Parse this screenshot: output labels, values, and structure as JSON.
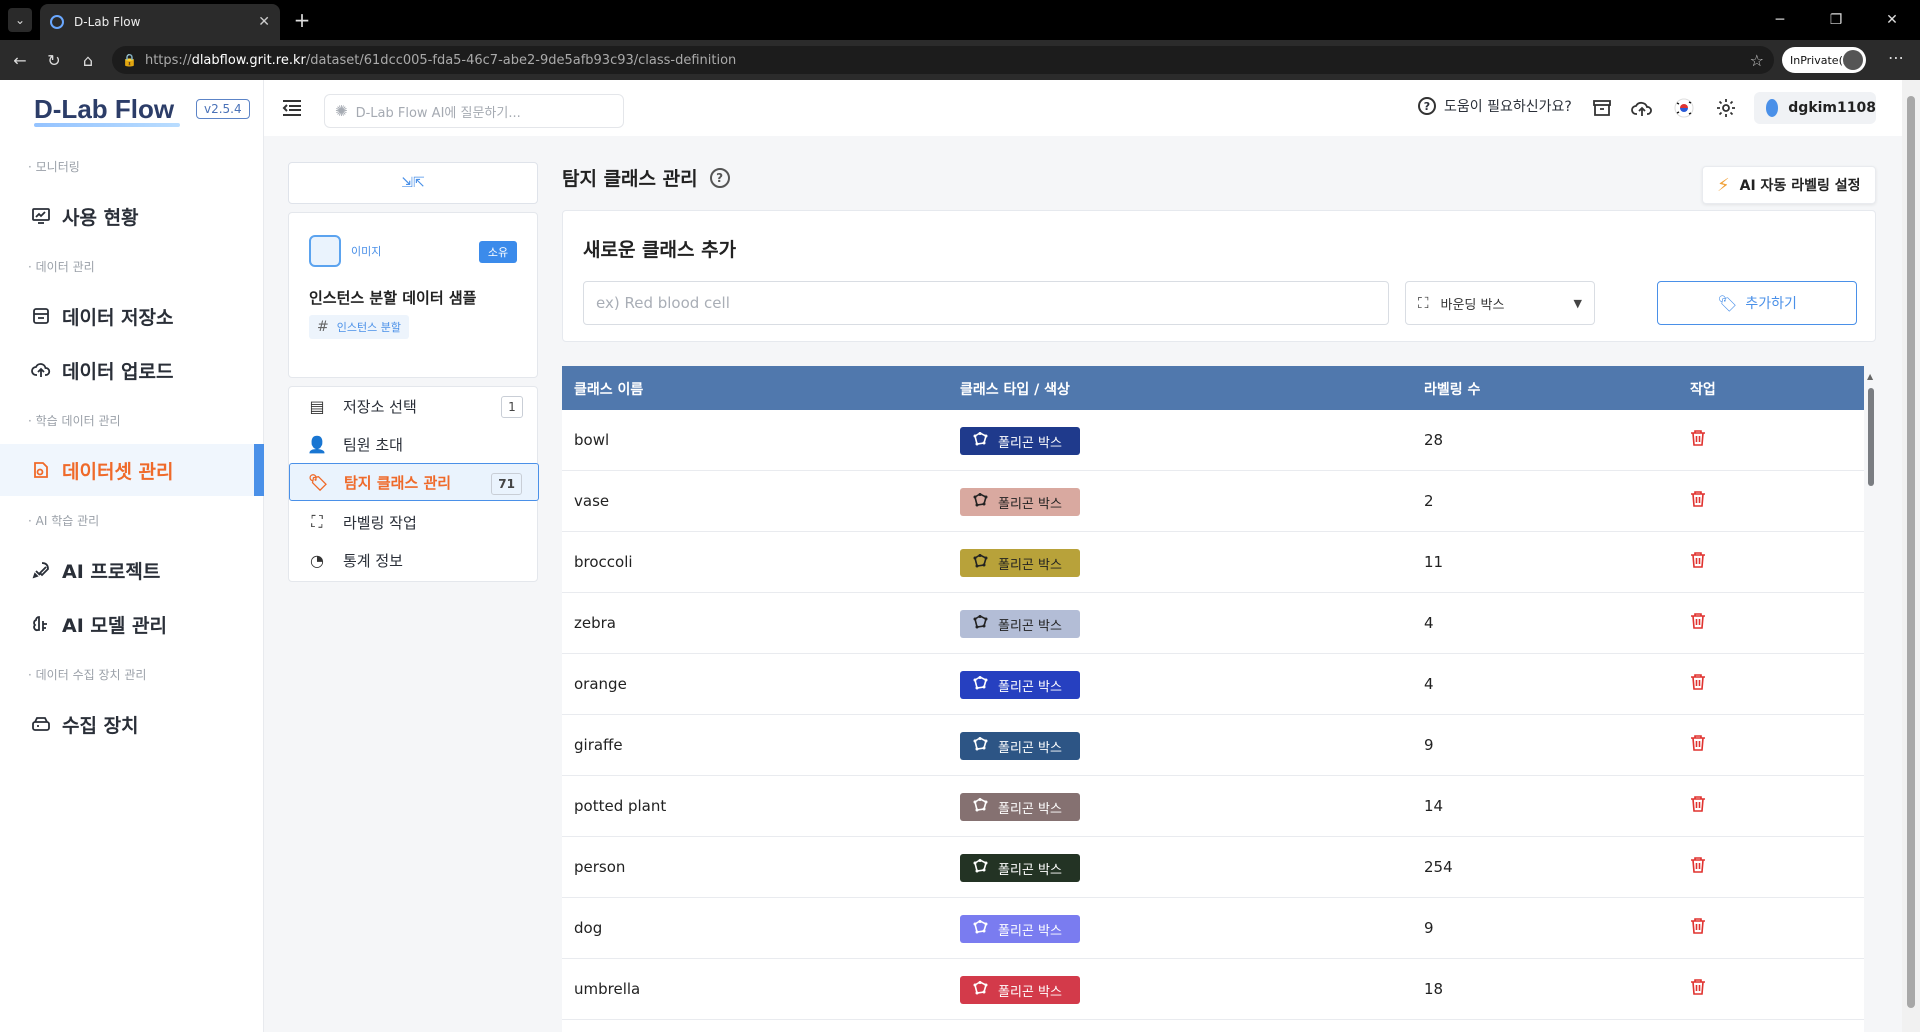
{
  "browser": {
    "tab_title": "D-Lab Flow",
    "url_prefix": "https://",
    "url_host": "dlabflow.grit.re.kr",
    "url_path": "/dataset/61dcc005-fda5-46c7-abe2-9de5afb93c93/class-definition",
    "inprivate_label": "InPrivate(2)"
  },
  "logo": {
    "text": "D-Lab Flow",
    "version": "v2.5.4"
  },
  "sidebar": {
    "sections": [
      {
        "label": "· 모니터링",
        "items": [
          {
            "label": "사용 현황",
            "icon": "monitor-chart-icon"
          }
        ]
      },
      {
        "label": "· 데이터 관리",
        "items": [
          {
            "label": "데이터 저장소",
            "icon": "storage-icon"
          },
          {
            "label": "데이터 업로드",
            "icon": "cloud-upload-icon"
          }
        ]
      },
      {
        "label": "· 학습 데이터 관리",
        "items": [
          {
            "label": "데이터셋 관리",
            "icon": "dataset-icon",
            "active": true
          }
        ]
      },
      {
        "label": "· AI 학습 관리",
        "items": [
          {
            "label": "AI 프로젝트",
            "icon": "rocket-icon"
          },
          {
            "label": "AI 모델 관리",
            "icon": "brain-icon"
          }
        ]
      },
      {
        "label": "· 데이터 수집 장치 관리",
        "items": [
          {
            "label": "수집 장치",
            "icon": "device-icon"
          }
        ]
      }
    ]
  },
  "header": {
    "ai_search_placeholder": "D-Lab Flow AI에 질문하기...",
    "help_label": "도움이 필요하신가요?",
    "username": "dgkim1108"
  },
  "dataset": {
    "type_label": "이미지",
    "badge": "소유",
    "title": "인스턴스 분할 데이터 샘플",
    "tag": "인스턴스 분할"
  },
  "dataset_menu": [
    {
      "label": "저장소 선택",
      "icon": "storage-icon",
      "count": "1"
    },
    {
      "label": "팀원 초대",
      "icon": "user-add-icon",
      "count": null
    },
    {
      "label": "탐지 클래스 관리",
      "icon": "tag-icon",
      "count": "71",
      "active": true
    },
    {
      "label": "라벨링 작업",
      "icon": "bbox-icon",
      "count": null
    },
    {
      "label": "통계 정보",
      "icon": "pie-chart-icon",
      "count": null
    }
  ],
  "page": {
    "title": "탐지 클래스 관리",
    "ai_button": "AI 자동 라벨링 설정",
    "add_title": "새로운 클래스 추가",
    "input_placeholder": "ex) Red blood cell",
    "type_selected": "바운딩 박스",
    "add_button": "추가하기"
  },
  "table": {
    "headers": {
      "name": "클래스 이름",
      "type": "클래스 타입 / 색상",
      "count": "라벨링 수",
      "action": "작업"
    },
    "rows": [
      {
        "name": "bowl",
        "type": "폴리곤 박스",
        "color": "#1f3a8c",
        "text_color": "#ffffff",
        "count": "28"
      },
      {
        "name": "vase",
        "type": "폴리곤 박스",
        "color": "#d9a9a0",
        "text_color": "#222222",
        "count": "2"
      },
      {
        "name": "broccoli",
        "type": "폴리곤 박스",
        "color": "#b8a23a",
        "text_color": "#222222",
        "count": "11"
      },
      {
        "name": "zebra",
        "type": "폴리곤 박스",
        "color": "#b3bdd6",
        "text_color": "#222222",
        "count": "4"
      },
      {
        "name": "orange",
        "type": "폴리곤 박스",
        "color": "#2640c0",
        "text_color": "#ffffff",
        "count": "4"
      },
      {
        "name": "giraffe",
        "type": "폴리곤 박스",
        "color": "#2d5585",
        "text_color": "#ffffff",
        "count": "9"
      },
      {
        "name": "potted plant",
        "type": "폴리곤 박스",
        "color": "#857171",
        "text_color": "#ffffff",
        "count": "14"
      },
      {
        "name": "person",
        "type": "폴리곤 박스",
        "color": "#233324",
        "text_color": "#ffffff",
        "count": "254"
      },
      {
        "name": "dog",
        "type": "폴리곤 박스",
        "color": "#7a7cf0",
        "text_color": "#ffffff",
        "count": "9"
      },
      {
        "name": "umbrella",
        "type": "폴리곤 박스",
        "color": "#d33a4a",
        "text_color": "#ffffff",
        "count": "18"
      }
    ]
  },
  "colors": {
    "accent": "#4a90e8",
    "active_orange": "#ef6a2a",
    "table_header": "#5078ad",
    "delete_red": "#e0322f"
  }
}
